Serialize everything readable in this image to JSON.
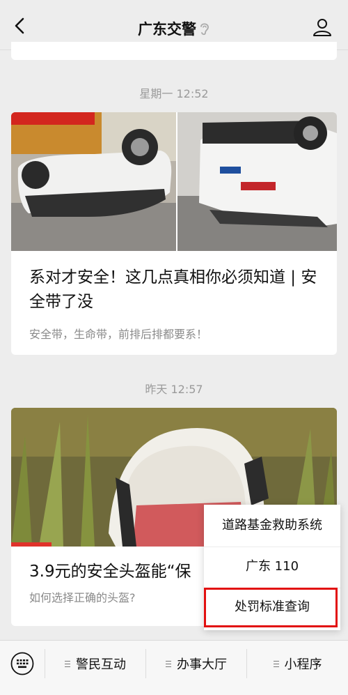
{
  "header": {
    "title": "广东交警"
  },
  "feed": {
    "time_1": "星期一 12:52",
    "article_1": {
      "headline": "系对才安全！这几点真相你必须知道 | 安全带了没",
      "summary": "安全带，生命带，前排后排都要系！"
    },
    "time_2": "昨天 12:57",
    "article_2": {
      "headline": "3.9元的安全头盔能“保",
      "summary": "如何选择正确的头盔?"
    }
  },
  "popup_menu": {
    "items": [
      "道路基金救助系统",
      "广东 110",
      "处罚标准查询"
    ]
  },
  "bottom_menu": {
    "items": [
      "警民互动",
      "办事大厅",
      "小程序"
    ]
  },
  "colors": {
    "highlight": "#e21010",
    "background": "#ededed"
  }
}
